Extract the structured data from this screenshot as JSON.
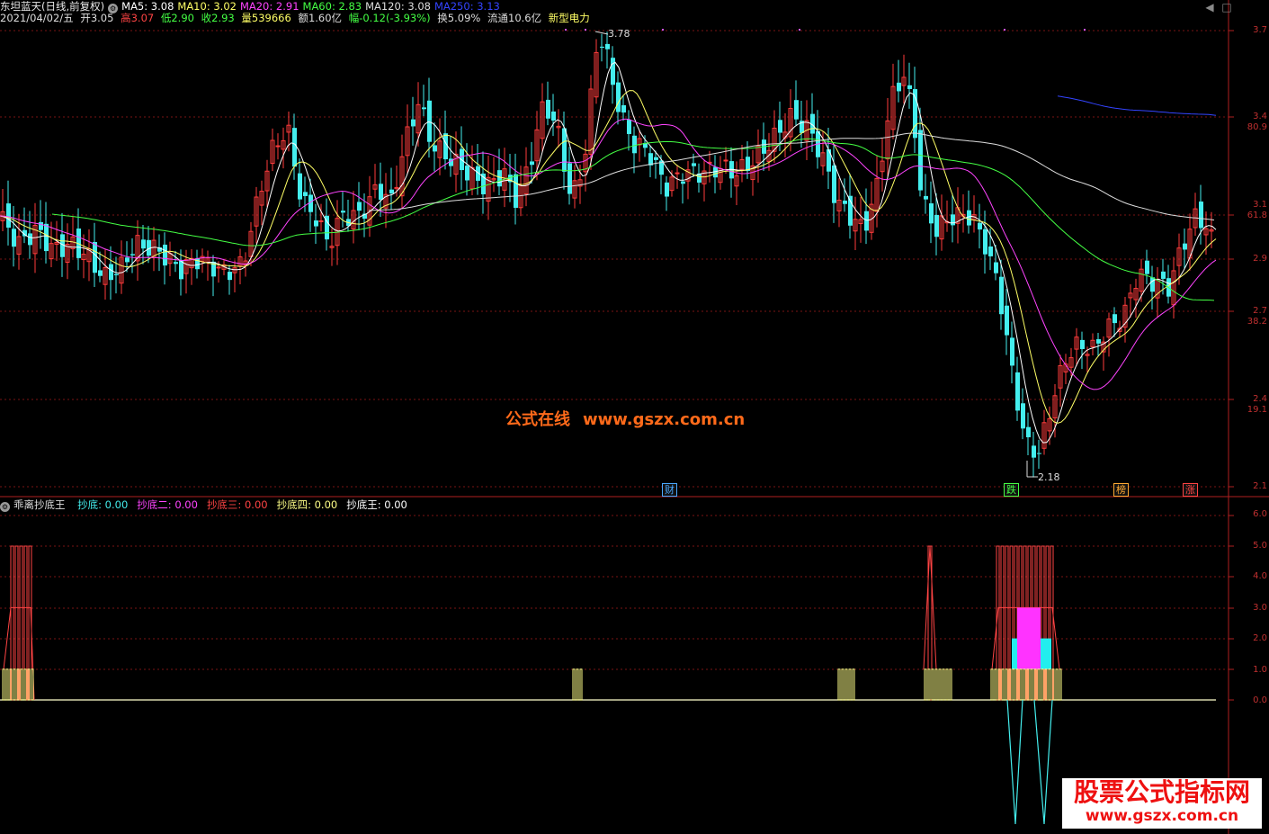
{
  "header": {
    "title": "东坦蓝天(日线,前复权)",
    "ma_values": [
      {
        "label": "MA5: 3.08",
        "color": "#ffffff"
      },
      {
        "label": "MA10: 3.02",
        "color": "#ffff66"
      },
      {
        "label": "MA20: 2.91",
        "color": "#ff44ff"
      },
      {
        "label": "MA60: 2.83",
        "color": "#44ff44"
      },
      {
        "label": "MA120: 3.08",
        "color": "#dddddd"
      },
      {
        "label": "MA250: 3.13",
        "color": "#3344ff"
      }
    ]
  },
  "quote": {
    "date": "2021/04/02/五",
    "open": "开3.05",
    "high": "高3.07",
    "low": "低2.90",
    "close": "收2.93",
    "volume": "量539666",
    "amount": "额1.60亿",
    "change": "幅-0.12(-3.93%)",
    "turnover": "换5.09%",
    "float": "流通10.6亿",
    "sector": "新型电力"
  },
  "price_axis": [
    "3.7",
    "3.4",
    "80.9",
    "3.1",
    "61.8",
    "2.9",
    "2.7",
    "38.2",
    "2.4",
    "19.1",
    "2.1"
  ],
  "annotations": {
    "high_price": "3.78",
    "low_price": "2.18"
  },
  "event_tags": [
    {
      "label": "财",
      "color": "#4aa8ff"
    },
    {
      "label": "跌",
      "color": "#44ff44"
    },
    {
      "label": "榜",
      "color": "#ffaa33"
    },
    {
      "label": "涨",
      "color": "#ff4444"
    }
  ],
  "indicator": {
    "name": "乖离抄底王",
    "values": [
      {
        "label": "抄底: 0.00",
        "color": "#44eeee"
      },
      {
        "label": "抄底二: 0.00",
        "color": "#ff44ff"
      },
      {
        "label": "抄底三: 0.00",
        "color": "#ff4444"
      },
      {
        "label": "抄底四: 0.00",
        "color": "#ffff88"
      },
      {
        "label": "抄底王: 0.00",
        "color": "#ffffff"
      }
    ],
    "axis": [
      "6.0",
      "5.0",
      "4.0",
      "3.0",
      "2.0",
      "1.0",
      "0.0"
    ]
  },
  "watermarks": {
    "center_cn": "公式在线",
    "center_url": "www.gszx.com.cn",
    "box_title": "股票公式指标网",
    "box_url": "www.gszx.com.cn"
  },
  "window_controls": {
    "minimize": "◀",
    "restore": "□"
  }
}
